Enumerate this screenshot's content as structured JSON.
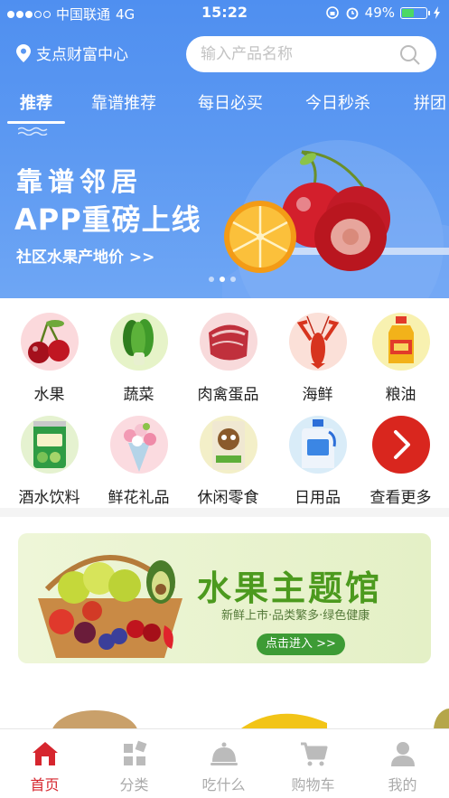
{
  "status_bar": {
    "carrier": "中国联通",
    "network": "4G",
    "time": "15:22",
    "battery": "49%",
    "battery_level": 0.49
  },
  "location": {
    "name": "支点财富中心"
  },
  "search": {
    "placeholder": "输入产品名称"
  },
  "tabs": [
    {
      "label": "推荐",
      "active": true
    },
    {
      "label": "靠谱推荐"
    },
    {
      "label": "每日必买"
    },
    {
      "label": "今日秒杀"
    },
    {
      "label": "拼团"
    }
  ],
  "banner": {
    "title_line1": "靠谱邻居",
    "title_line2": "APP重磅上线",
    "subtitle": "社区水果产地价 >>",
    "page_count": 3,
    "active_page": 1
  },
  "categories": [
    {
      "label": "水果",
      "icon": "cherry-icon"
    },
    {
      "label": "蔬菜",
      "icon": "vegetable-icon"
    },
    {
      "label": "肉禽蛋品",
      "icon": "meat-icon"
    },
    {
      "label": "海鲜",
      "icon": "lobster-icon"
    },
    {
      "label": "粮油",
      "icon": "oil-bottle-icon"
    },
    {
      "label": "酒水饮料",
      "icon": "drink-can-icon"
    },
    {
      "label": "鲜花礼品",
      "icon": "flower-bouquet-icon"
    },
    {
      "label": "休闲零食",
      "icon": "snack-bag-icon"
    },
    {
      "label": "日用品",
      "icon": "detergent-bottle-icon"
    },
    {
      "label": "查看更多",
      "icon": "chevron-right-icon"
    }
  ],
  "fruit_hall": {
    "title": "水果主题馆",
    "subtitle": "新鲜上市·品类繁多·绿色健康",
    "button": "点击进入 >>"
  },
  "bottom_nav": [
    {
      "label": "首页",
      "icon": "home-icon",
      "active": true
    },
    {
      "label": "分类",
      "icon": "category-grid-icon"
    },
    {
      "label": "吃什么",
      "icon": "food-cloche-icon"
    },
    {
      "label": "购物车",
      "icon": "cart-icon"
    },
    {
      "label": "我的",
      "icon": "user-icon"
    }
  ],
  "colors": {
    "header_blue": "#4f8ff0",
    "accent_red": "#d6262e",
    "hall_green": "#4c9a1e"
  }
}
